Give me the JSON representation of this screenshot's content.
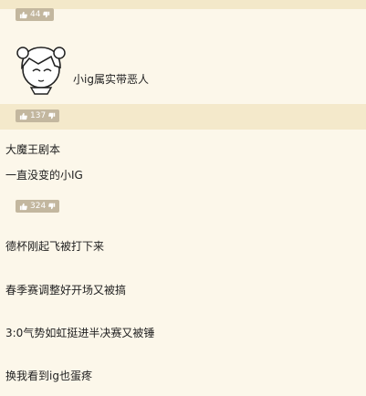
{
  "comments": [
    {
      "likes": "44",
      "text": ""
    },
    {
      "likes": "",
      "text": "小ig属实带恶人"
    },
    {
      "likes": "137",
      "lines": [
        "大魔王剧本",
        "一直没变的小IG"
      ]
    },
    {
      "likes": "324",
      "lines": [
        "德杯刚起飞被打下来",
        "春季赛调整好开场又被搞",
        "3:0气势如虹挺进半决赛又被锤",
        "换我看到ig也蛋疼"
      ]
    }
  ],
  "icons": {
    "like": "thumbs-up-icon",
    "dislike": "thumbs-down-icon"
  },
  "colors": {
    "badge": "#c3b79f",
    "background": "#fbf5e5",
    "accent_band": "#f4e9cb"
  }
}
